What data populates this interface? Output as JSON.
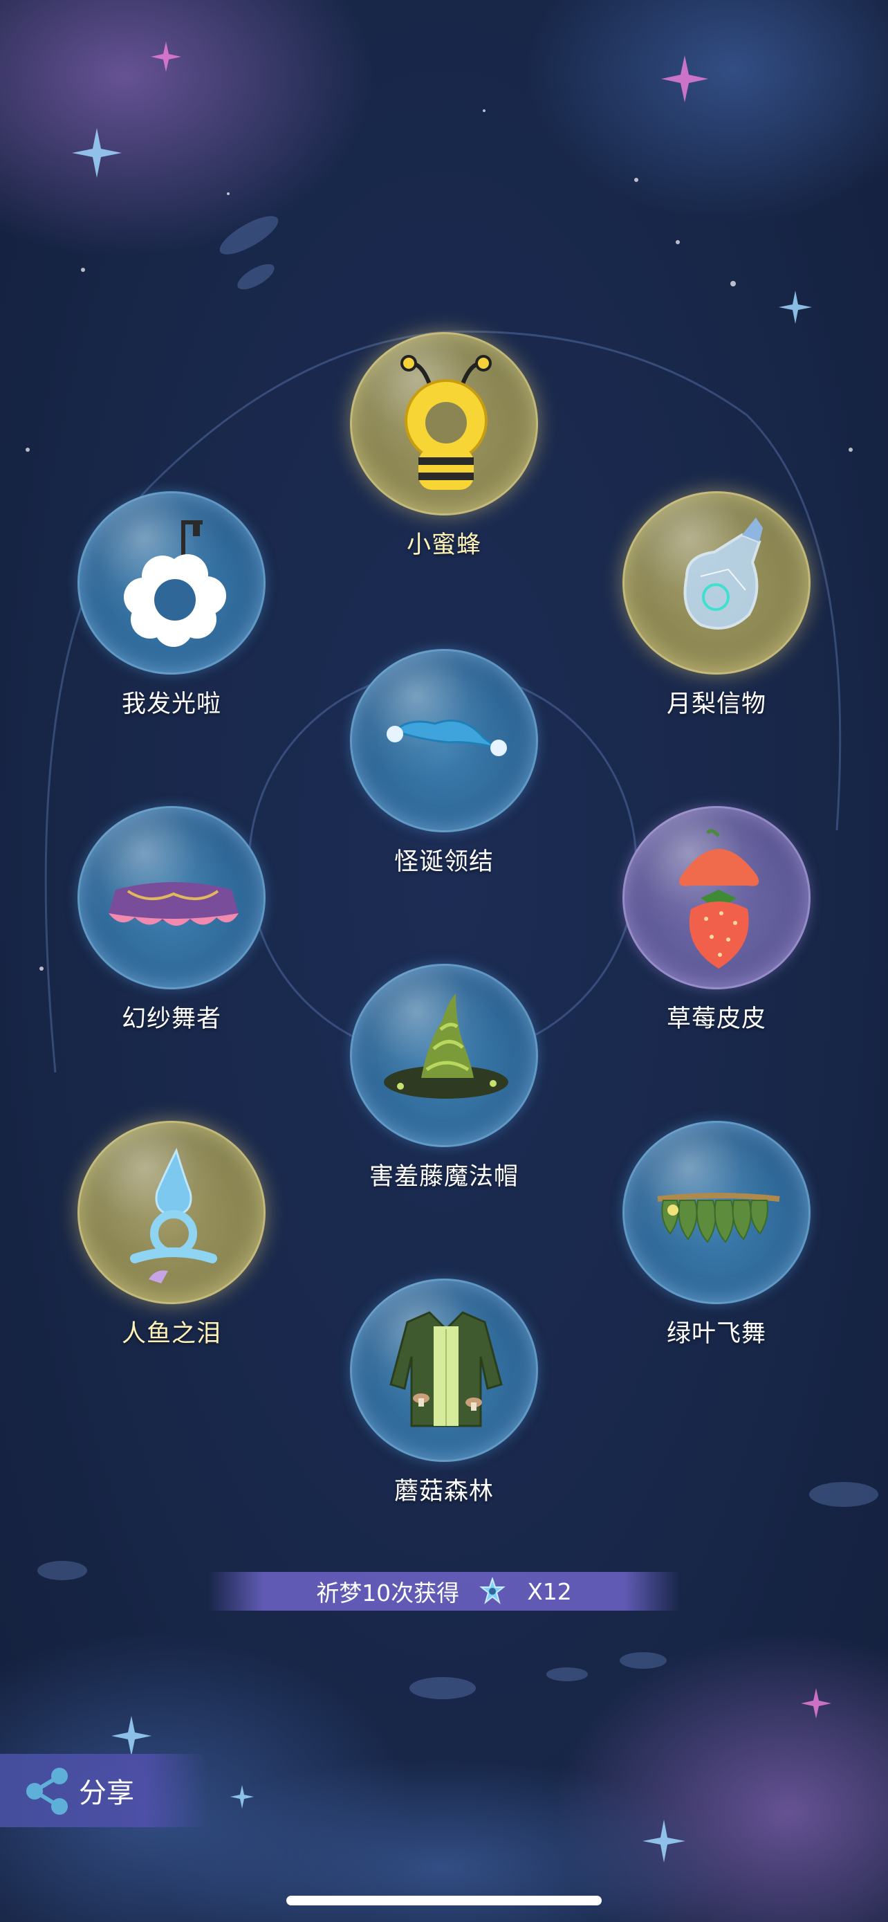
{
  "items": [
    {
      "name": "小蜜蜂",
      "bubble_color": "gold"
    },
    {
      "name": "我发光啦",
      "bubble_color": "blue"
    },
    {
      "name": "月梨信物",
      "bubble_color": "gold"
    },
    {
      "name": "怪诞领结",
      "bubble_color": "blue"
    },
    {
      "name": "幻纱舞者",
      "bubble_color": "blue"
    },
    {
      "name": "草莓皮皮",
      "bubble_color": "purple"
    },
    {
      "name": "害羞藤魔法帽",
      "bubble_color": "blue"
    },
    {
      "name": "人鱼之泪",
      "bubble_color": "gold"
    },
    {
      "name": "绿叶飞舞",
      "bubble_color": "blue"
    },
    {
      "name": "蘑菇森林",
      "bubble_color": "blue"
    }
  ],
  "reward": {
    "text": "祈梦10次获得",
    "icon": "blue-star-icon",
    "count": "X12"
  },
  "share": {
    "label": "分享",
    "icon": "share-icon"
  },
  "colors": {
    "background": "#182749",
    "gold_glow": "#f0d778",
    "blue_bubble": "#2f6898",
    "reward_bar": "#6e64c8"
  }
}
